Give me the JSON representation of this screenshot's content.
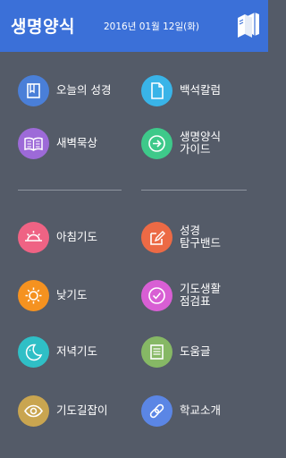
{
  "header": {
    "title": "생명양식",
    "date": "2016년 01월 12일(화)",
    "book_icon": "books-icon"
  },
  "menu": {
    "today_bible": {
      "label": "오늘의 성경",
      "icon": "bible-icon",
      "color": "#4a7fd8"
    },
    "baekseok_column": {
      "label": "백석칼럼",
      "icon": "document-icon",
      "color": "#39b4e8"
    },
    "dawn_devotion": {
      "label": "새벽묵상",
      "icon": "open-book-icon",
      "color": "#9d6ad8"
    },
    "guide": {
      "label": "생명양식\n가이드",
      "icon": "arrow-right-circle-icon",
      "color": "#3ec98a"
    },
    "morning_prayer": {
      "label": "아침기도",
      "icon": "sunrise-icon",
      "color": "#ef6384"
    },
    "bible_study_band": {
      "label": "성경\n탐구밴드",
      "icon": "edit-icon",
      "color": "#ec6a45"
    },
    "noon_prayer": {
      "label": "낮기도",
      "icon": "sun-icon",
      "color": "#f59220"
    },
    "prayer_checklist": {
      "label": "기도생활\n점검표",
      "icon": "check-circle-icon",
      "color": "#d85fd4"
    },
    "evening_prayer": {
      "label": "저녁기도",
      "icon": "moon-icon",
      "color": "#2fbfc6"
    },
    "help": {
      "label": "도움글",
      "icon": "list-icon",
      "color": "#86b865"
    },
    "prayer_guide": {
      "label": "기도길잡이",
      "icon": "eye-icon",
      "color": "#c9a550"
    },
    "school_intro": {
      "label": "학교소개",
      "icon": "link-icon",
      "color": "#5b86e5"
    }
  }
}
